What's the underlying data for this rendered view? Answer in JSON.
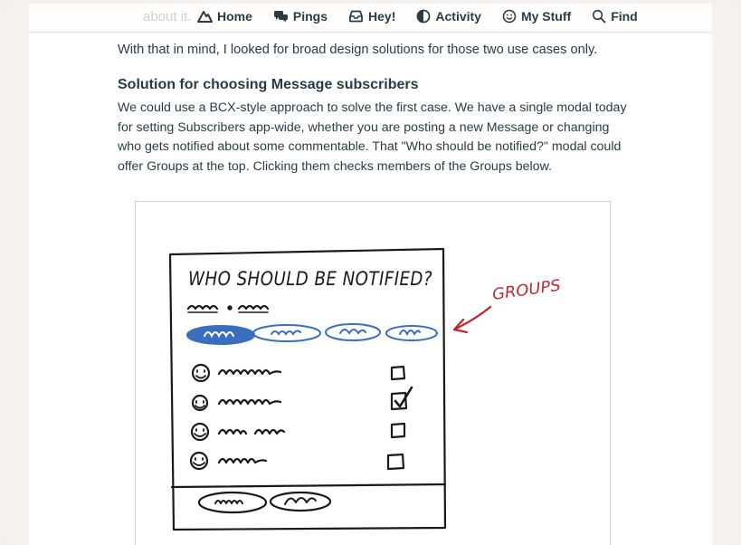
{
  "nav": {
    "faded_text": "about it.",
    "items": [
      {
        "label": "Home",
        "icon": "mountain-icon"
      },
      {
        "label": "Pings",
        "icon": "chat-bubbles-icon"
      },
      {
        "label": "Hey!",
        "icon": "inbox-icon"
      },
      {
        "label": "Activity",
        "icon": "half-circle-icon"
      },
      {
        "label": "My Stuff",
        "icon": "smiley-icon"
      },
      {
        "label": "Find",
        "icon": "search-icon"
      }
    ]
  },
  "article": {
    "lead": "With that in mind, I looked for broad design solutions for those two use cases only.",
    "heading": "Solution for choosing Message subscribers",
    "paragraph_lines": [
      "We could use a BCX-style approach to solve the first case. We have a single modal today",
      "for setting Subscribers app-wide, whether you are posting a new Message or changing",
      "who gets notified about some commentable. That \"Who should be notified?\" modal could",
      "offer Groups at the top. Clicking them checks members of the Groups below."
    ]
  },
  "sketch": {
    "title": "WHO SHOULD BE NOTIFIED?",
    "annotation": "GROUPS",
    "colors": {
      "ink": "#1a1a1a",
      "blue": "#3a6fc0",
      "red": "#c0262b"
    }
  }
}
